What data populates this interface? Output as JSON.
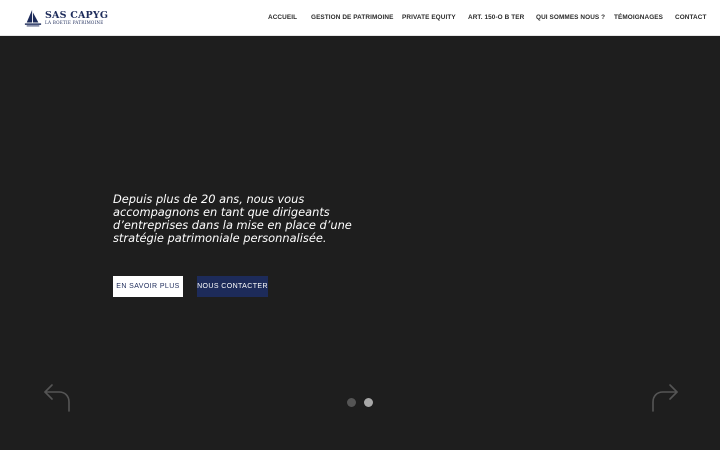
{
  "brand": {
    "name": "SAS CAPYG",
    "subtitle": "LA BOETIE PATRIMOINE",
    "color": "#1d2b5a"
  },
  "nav": {
    "items": [
      {
        "label": "ACCUEIL"
      },
      {
        "label": "GESTION DE PATRIMOINE"
      },
      {
        "label": "PRIVATE EQUITY"
      },
      {
        "label": "ART. 150-O B TER"
      },
      {
        "label": "QUI SOMMES NOUS ?"
      },
      {
        "label": "TÉMOIGNAGES"
      },
      {
        "label": "CONTACT"
      }
    ]
  },
  "hero": {
    "tagline": "Depuis plus de 20 ans, nous vous accompagnons en tant que dirigeants d’entreprises dans la mise en place d’une stratégie patrimoniale personnalisée.",
    "primary_button": "EN SAVOIR PLUS",
    "secondary_button": "NOUS CONTACTER",
    "background_color": "#1e1e1e",
    "prev_arrow_icon": "arrow-back-icon",
    "next_arrow_icon": "arrow-forward-icon"
  },
  "slider": {
    "slide_count": 2,
    "active_slide": 2
  }
}
